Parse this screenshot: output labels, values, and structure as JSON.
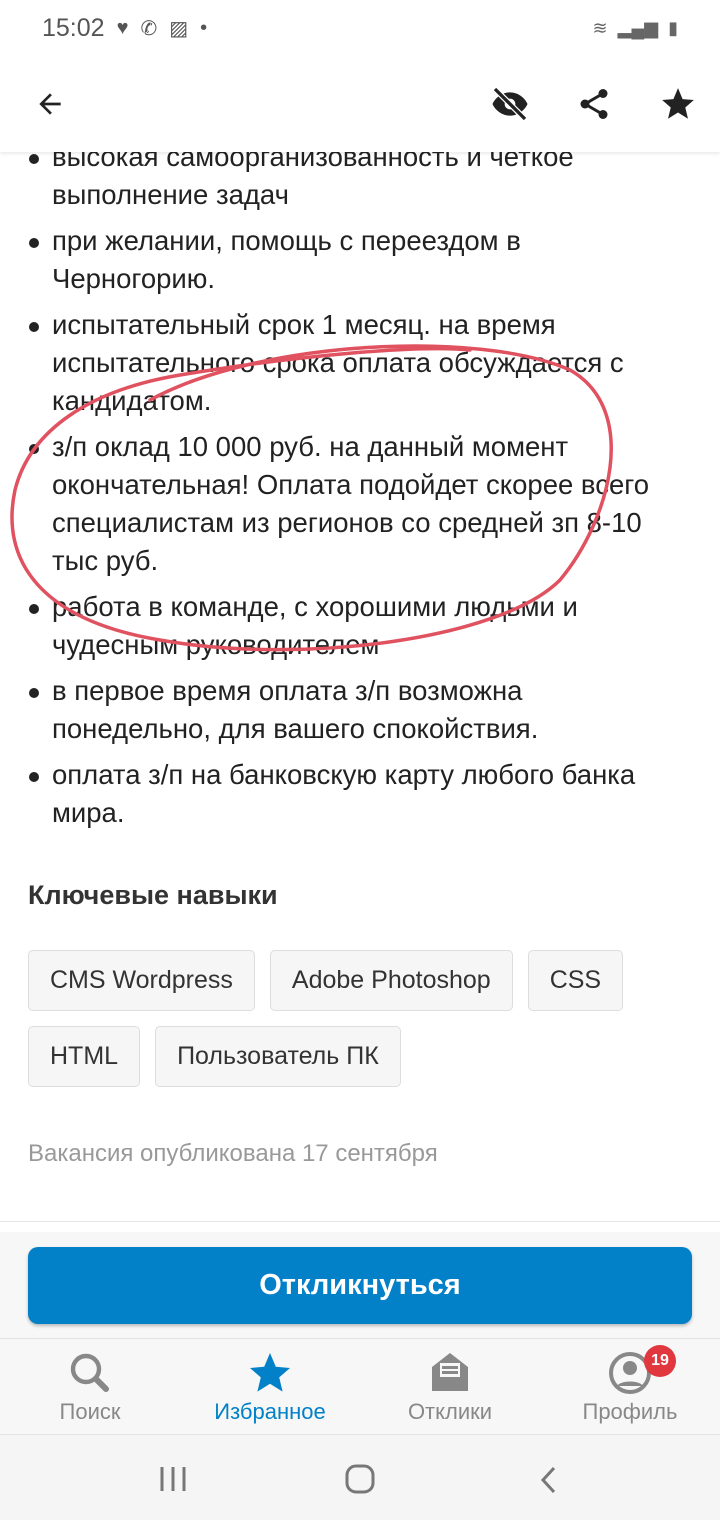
{
  "status_bar": {
    "time": "15:02",
    "icons": [
      "heart-icon",
      "viber-icon",
      "image-icon",
      "dot-icon",
      "wifi-icon",
      "signal-icon",
      "battery-charging-icon"
    ]
  },
  "header": {
    "icons": [
      "back-arrow-icon",
      "hide-eye-icon",
      "share-icon",
      "star-icon"
    ]
  },
  "requirements": [
    "высокая самоорганизованность и четкое выполнение задач",
    "при желании, помощь с переездом в Черногорию.",
    "испытательный срок 1 месяц. на время испытательного срока оплата обсуждается с кандидатом.",
    "з/п оклад 10 000 руб. на данный момент окончательная! Оплата подойдет скорее всего специалистам из регионов со средней зп 8-10 тыс руб.",
    "работа в команде, с хорошими людьми и чудесным руководителем",
    "в первое время оплата з/п возможна понедельно, для вашего спокойствия.",
    "оплата з/п на банковскую карту любого банка мира."
  ],
  "skills": {
    "title": "Ключевые навыки",
    "items": [
      "CMS Wordpress",
      "Adobe Photoshop",
      "CSS",
      "HTML",
      "Пользователь ПК"
    ]
  },
  "published": "Вакансия опубликована 17 сентября",
  "apply_label": "Откликнуться",
  "bottom_nav": {
    "items": [
      {
        "label": "Поиск",
        "icon": "search-icon"
      },
      {
        "label": "Избранное",
        "icon": "star-icon",
        "active": true
      },
      {
        "label": "Отклики",
        "icon": "responses-icon"
      },
      {
        "label": "Профиль",
        "icon": "profile-icon",
        "badge": "19"
      }
    ]
  },
  "colors": {
    "accent": "#0280c8",
    "badge": "#e0383e",
    "annotation": "#e05260"
  }
}
